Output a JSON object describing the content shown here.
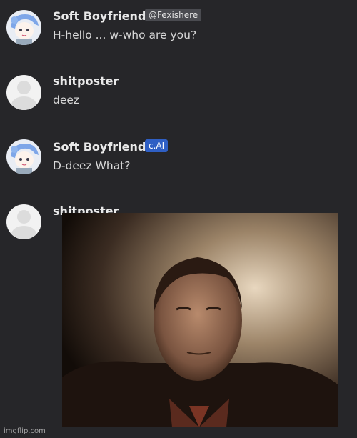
{
  "messages": [
    {
      "author": "Soft Boyfriend",
      "badge": "@Fexishere",
      "text": "H-hello ... w-who are you?"
    },
    {
      "author": "shitposter",
      "badge": "",
      "text": "deez"
    },
    {
      "author": "Soft Boyfriend",
      "badge": "c.AI",
      "text": "D-deez What?"
    },
    {
      "author": "shitposter",
      "badge": "",
      "text": ""
    }
  ],
  "colors": {
    "background": "#262629",
    "handle_badge": "#4a4b50",
    "cai_badge": "#2f5fc4"
  },
  "watermark": "imgflip.com"
}
